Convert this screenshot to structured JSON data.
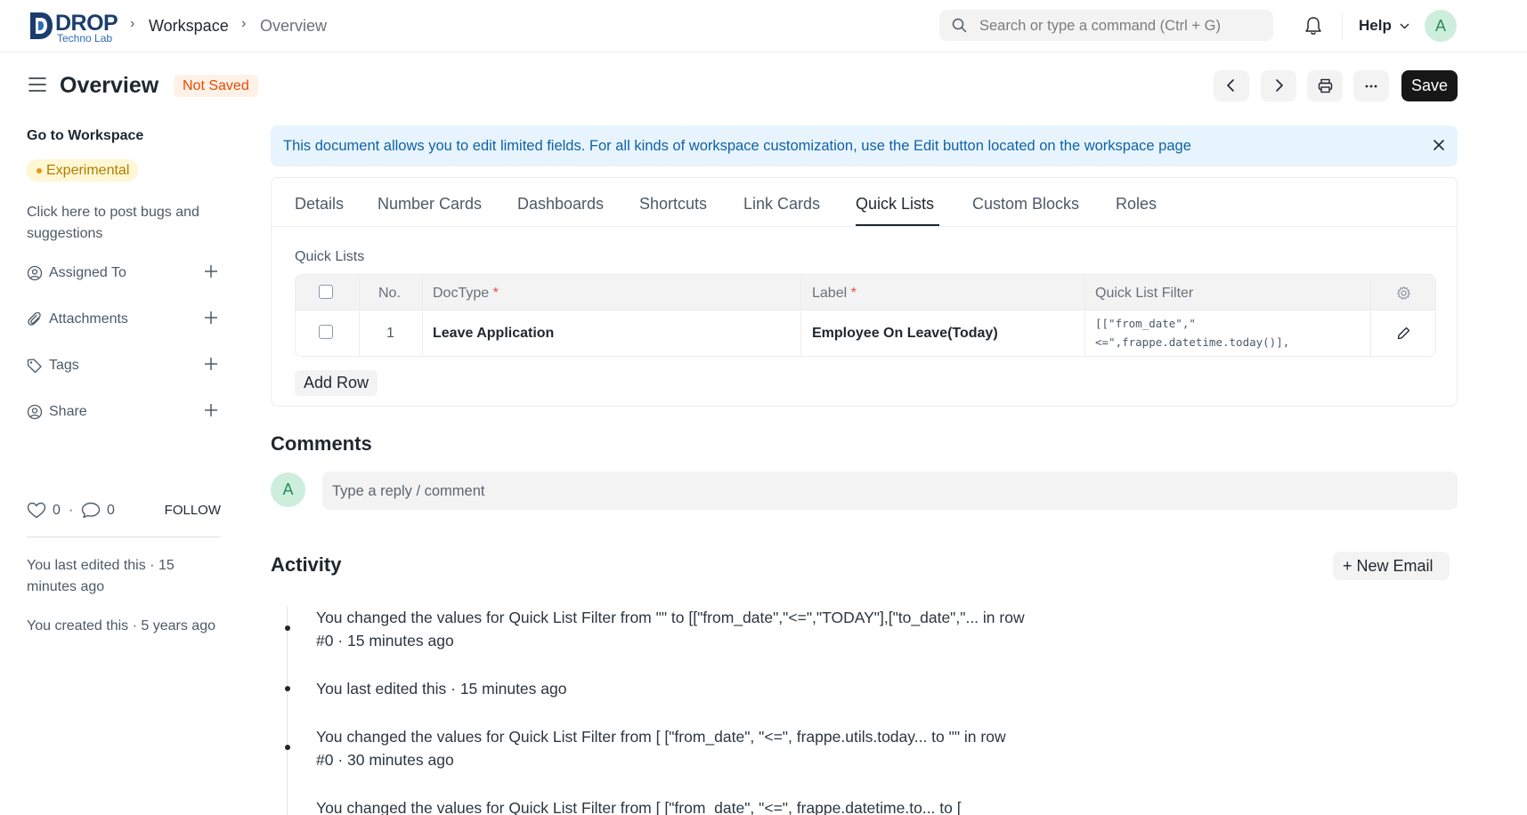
{
  "brand": {
    "name": "DROP",
    "tagline": "Techno Lab"
  },
  "breadcrumbs": [
    "Workspace",
    "Overview"
  ],
  "search": {
    "placeholder": "Search or type a command (Ctrl + G)"
  },
  "navbar": {
    "help_label": "Help",
    "avatar_initial": "A"
  },
  "page": {
    "title": "Overview",
    "status": "Not Saved",
    "save_label": "Save"
  },
  "sidebar": {
    "go_to": "Go to Workspace",
    "badge": "Experimental",
    "bug_text": "Click here to post bugs and suggestions",
    "items": [
      {
        "label": "Assigned To",
        "icon": "user-plus-icon"
      },
      {
        "label": "Attachments",
        "icon": "paperclip-icon"
      },
      {
        "label": "Tags",
        "icon": "tag-icon"
      },
      {
        "label": "Share",
        "icon": "share-user-icon"
      }
    ],
    "likes": "0",
    "comments": "0",
    "follow": "FOLLOW",
    "last_edited": "You last edited this · 15 minutes ago",
    "created": "You created this · 5 years ago"
  },
  "alert": {
    "text": "This document allows you to edit limited fields. For all kinds of workspace customization, use the Edit button located on the workspace page"
  },
  "tabs": [
    "Details",
    "Number Cards",
    "Dashboards",
    "Shortcuts",
    "Link Cards",
    "Quick Lists",
    "Custom Blocks",
    "Roles"
  ],
  "active_tab": "Quick Lists",
  "quick_lists": {
    "section_label": "Quick Lists",
    "columns": {
      "no": "No.",
      "doctype": "DocType",
      "label": "Label",
      "filter": "Quick List Filter",
      "required_mark": "*"
    },
    "rows": [
      {
        "no": "1",
        "doctype": "Leave Application",
        "label": "Employee On Leave(Today)",
        "filter_line1": "[[\"from_date\",\"",
        "filter_line2": "<=\",frappe.datetime.today()],"
      }
    ],
    "add_row": "Add Row"
  },
  "comments": {
    "heading": "Comments",
    "avatar_initial": "A",
    "placeholder": "Type a reply / comment"
  },
  "activity": {
    "heading": "Activity",
    "new_email": "+ New Email",
    "items": [
      {
        "line1": "You changed the values for Quick List Filter from \"\" to [[\"from_date\",\"<=\",\"TODAY\"],[\"to_date\",\"... in row",
        "line2": "#0 · 15 minutes ago"
      },
      {
        "line1": "You last edited this · 15 minutes ago",
        "line2": ""
      },
      {
        "line1": "You changed the values for Quick List Filter from [ [\"from_date\", \"<=\", frappe.utils.today... to \"\" in row",
        "line2": "#0 · 30 minutes ago"
      },
      {
        "line1": "You changed the values for Quick List Filter from [ [\"from_date\", \"<=\", frappe.datetime.to... to [",
        "line2": ""
      }
    ]
  },
  "colors": {
    "accent": "#171717",
    "warning": "#e24c00",
    "info": "#0f62a8",
    "avatar_bg": "#cdeedc"
  }
}
